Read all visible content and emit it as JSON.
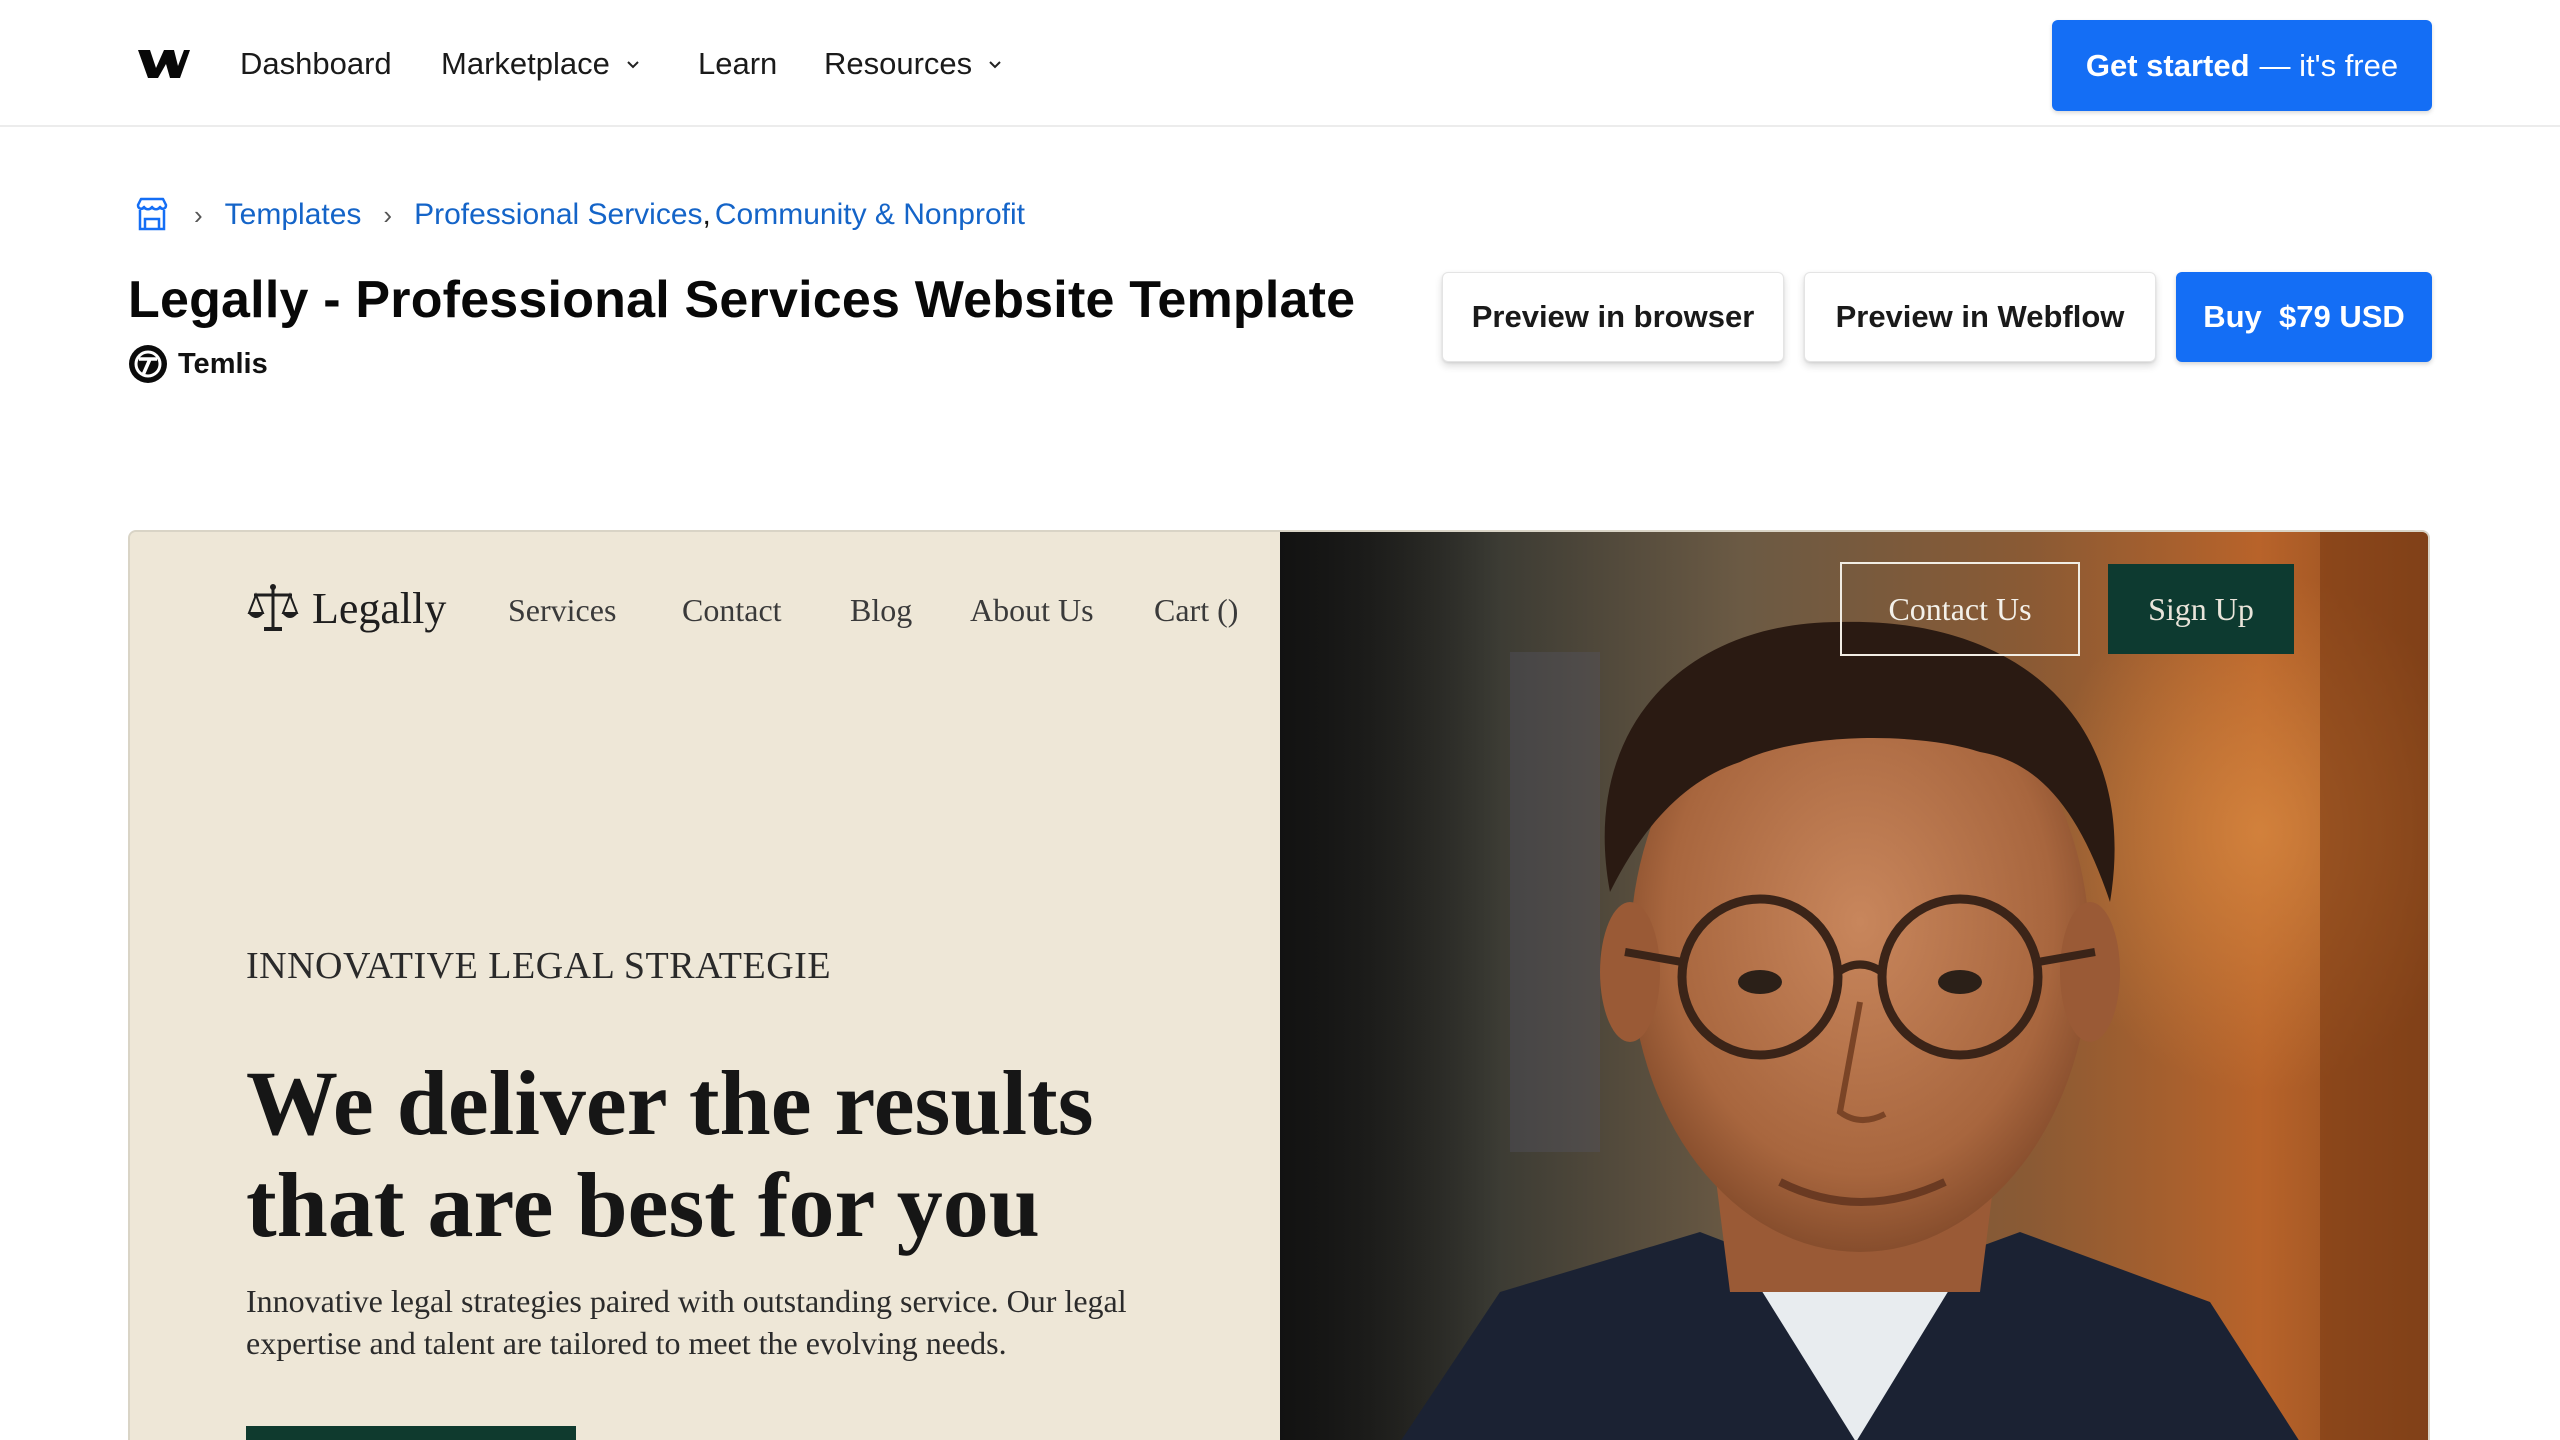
{
  "topnav": {
    "links": [
      {
        "label": "Dashboard"
      },
      {
        "label": "Marketplace"
      },
      {
        "label": "Learn"
      },
      {
        "label": "Resources"
      }
    ],
    "cta_bold": "Get started",
    "cta_light": "— it's free"
  },
  "breadcrumb": {
    "home_icon": "storefront-icon",
    "items": [
      "Templates",
      "Professional Services",
      "Community & Nonprofit"
    ],
    "separator": "›",
    "comma": ","
  },
  "template": {
    "title": "Legally - Professional Services Website Template",
    "author": "Temlis"
  },
  "actions": {
    "preview_browser": "Preview in browser",
    "preview_webflow": "Preview in Webflow",
    "buy": "Buy  $79 USD"
  },
  "preview": {
    "brand": "Legally",
    "nav": [
      "Services",
      "Contact",
      "Blog",
      "About Us",
      "Cart ()"
    ],
    "contact_button": "Contact Us",
    "signup_button": "Sign Up",
    "eyebrow": "INNOVATIVE LEGAL STRATEGIE",
    "headline": "We deliver the results that are best for you",
    "body": "Innovative legal strategies paired with outstanding service. Our legal expertise and talent are tailored to meet the evolving needs."
  },
  "colors": {
    "accent": "#146ef5",
    "preview_bg": "#eee7d7",
    "preview_dark_green": "#0d3a30"
  }
}
